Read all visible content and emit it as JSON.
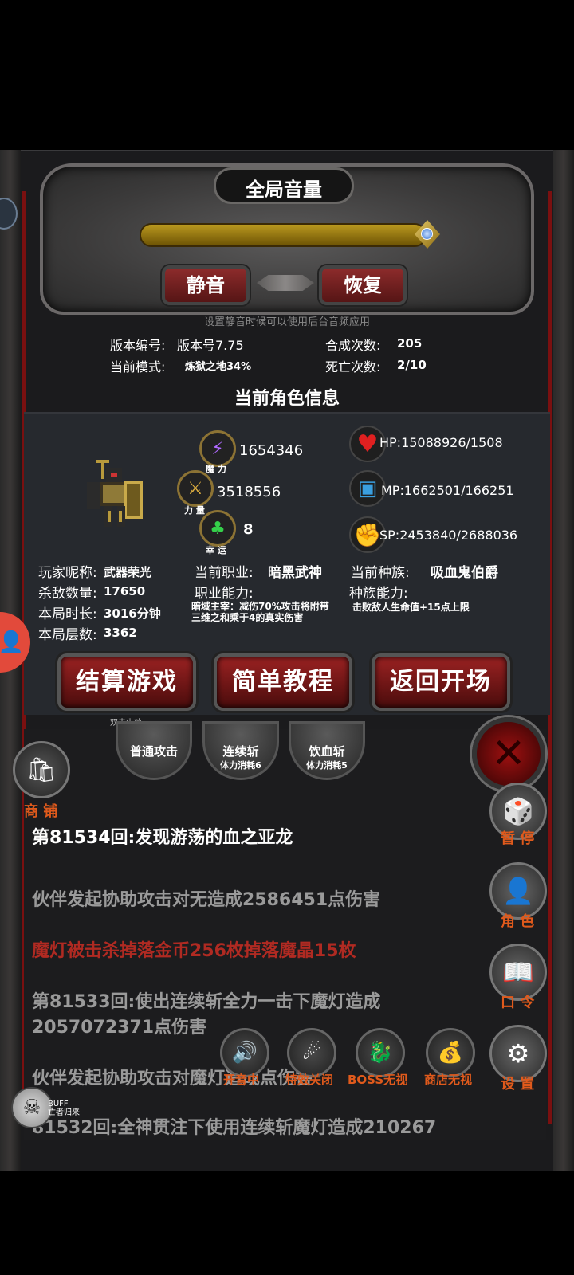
{
  "volume": {
    "title": "全局音量",
    "level_percent": 100,
    "mute_label": "静音",
    "restore_label": "恢复",
    "hint": "设置静音时候可以使用后台音频应用"
  },
  "game_info": {
    "version_label": "版本编号:",
    "version_value": "版本号7.75",
    "mode_label": "当前模式:",
    "mode_value": "炼狱之地34%",
    "synth_label": "合成次数:",
    "synth_value": "205",
    "death_label": "死亡次数:",
    "death_value": "2/10"
  },
  "character": {
    "section_title": "当前角色信息",
    "magic_value": "1654346",
    "magic_label": "魔 力",
    "strength_value": "3518556",
    "strength_label": "力 量",
    "luck_value": "8",
    "luck_label": "幸 运",
    "hp_text": "HP:15088926/1508",
    "mp_text": "MP:1662501/166251",
    "sp_text": "SP:2453840/2688036",
    "nickname_label": "玩家昵称:",
    "nickname_value": "武器荣光",
    "kills_label": "杀敌数量:",
    "kills_value": "17650",
    "duration_label": "本局时长:",
    "duration_value": "3016分钟",
    "floor_label": "本局层数:",
    "floor_value": "3362",
    "job_label": "当前职业:",
    "job_value": "暗黑武神",
    "job_ability_label": "职业能力:",
    "job_ability_desc_1": "暗域主宰：减伤70%攻击将附带",
    "job_ability_desc_2": "三维之和乘于4的真实伤害",
    "race_label": "当前种族:",
    "race_value": "吸血鬼伯爵",
    "race_ability_label": "种族能力:",
    "race_ability_desc": "击败敌人生命值+15点上限"
  },
  "actions": {
    "settle_label": "结算游戏",
    "settle_hint": "双击生效",
    "tutorial_label": "简单教程",
    "back_label": "返回开场"
  },
  "skills": [
    {
      "name": "普通攻击",
      "cost": ""
    },
    {
      "name": "连续斩",
      "cost": "体力消耗6"
    },
    {
      "name": "饮血斩",
      "cost": "体力消耗5"
    }
  ],
  "shop_label": "商 铺",
  "log": [
    {
      "text": "第81534回:发现游荡的血之亚龙",
      "color": "#ffffff"
    },
    {
      "text": "伙伴发起协助攻击对无造成2586451点伤害",
      "color": "#9a9a9a"
    },
    {
      "text": "魔灯被击杀掉落金币256枚掉落魔晶15枚",
      "color": "#b02a22"
    },
    {
      "text": "第81533回:使出连续斩全力一击下魔灯造成2057072371点伤害",
      "color": "#9a9a9a"
    },
    {
      "text": "伙伴发起协助攻击对魔灯造成点伤害",
      "color": "#9a9a9a"
    },
    {
      "text": "81532回:全神贯注下使用连续斩魔灯造成210267",
      "color": "#9a9a9a"
    }
  ],
  "side_buttons": {
    "pause": "暂 停",
    "role": "角 色",
    "code": "口 令",
    "settings": "设 置"
  },
  "bottom_buttons": {
    "sound": "开音中",
    "effects": "特效关闭",
    "boss": "BOSS无视",
    "shop_ignore": "商店无视"
  },
  "buff": {
    "title": "BUFF",
    "sub": "亡者归来"
  }
}
